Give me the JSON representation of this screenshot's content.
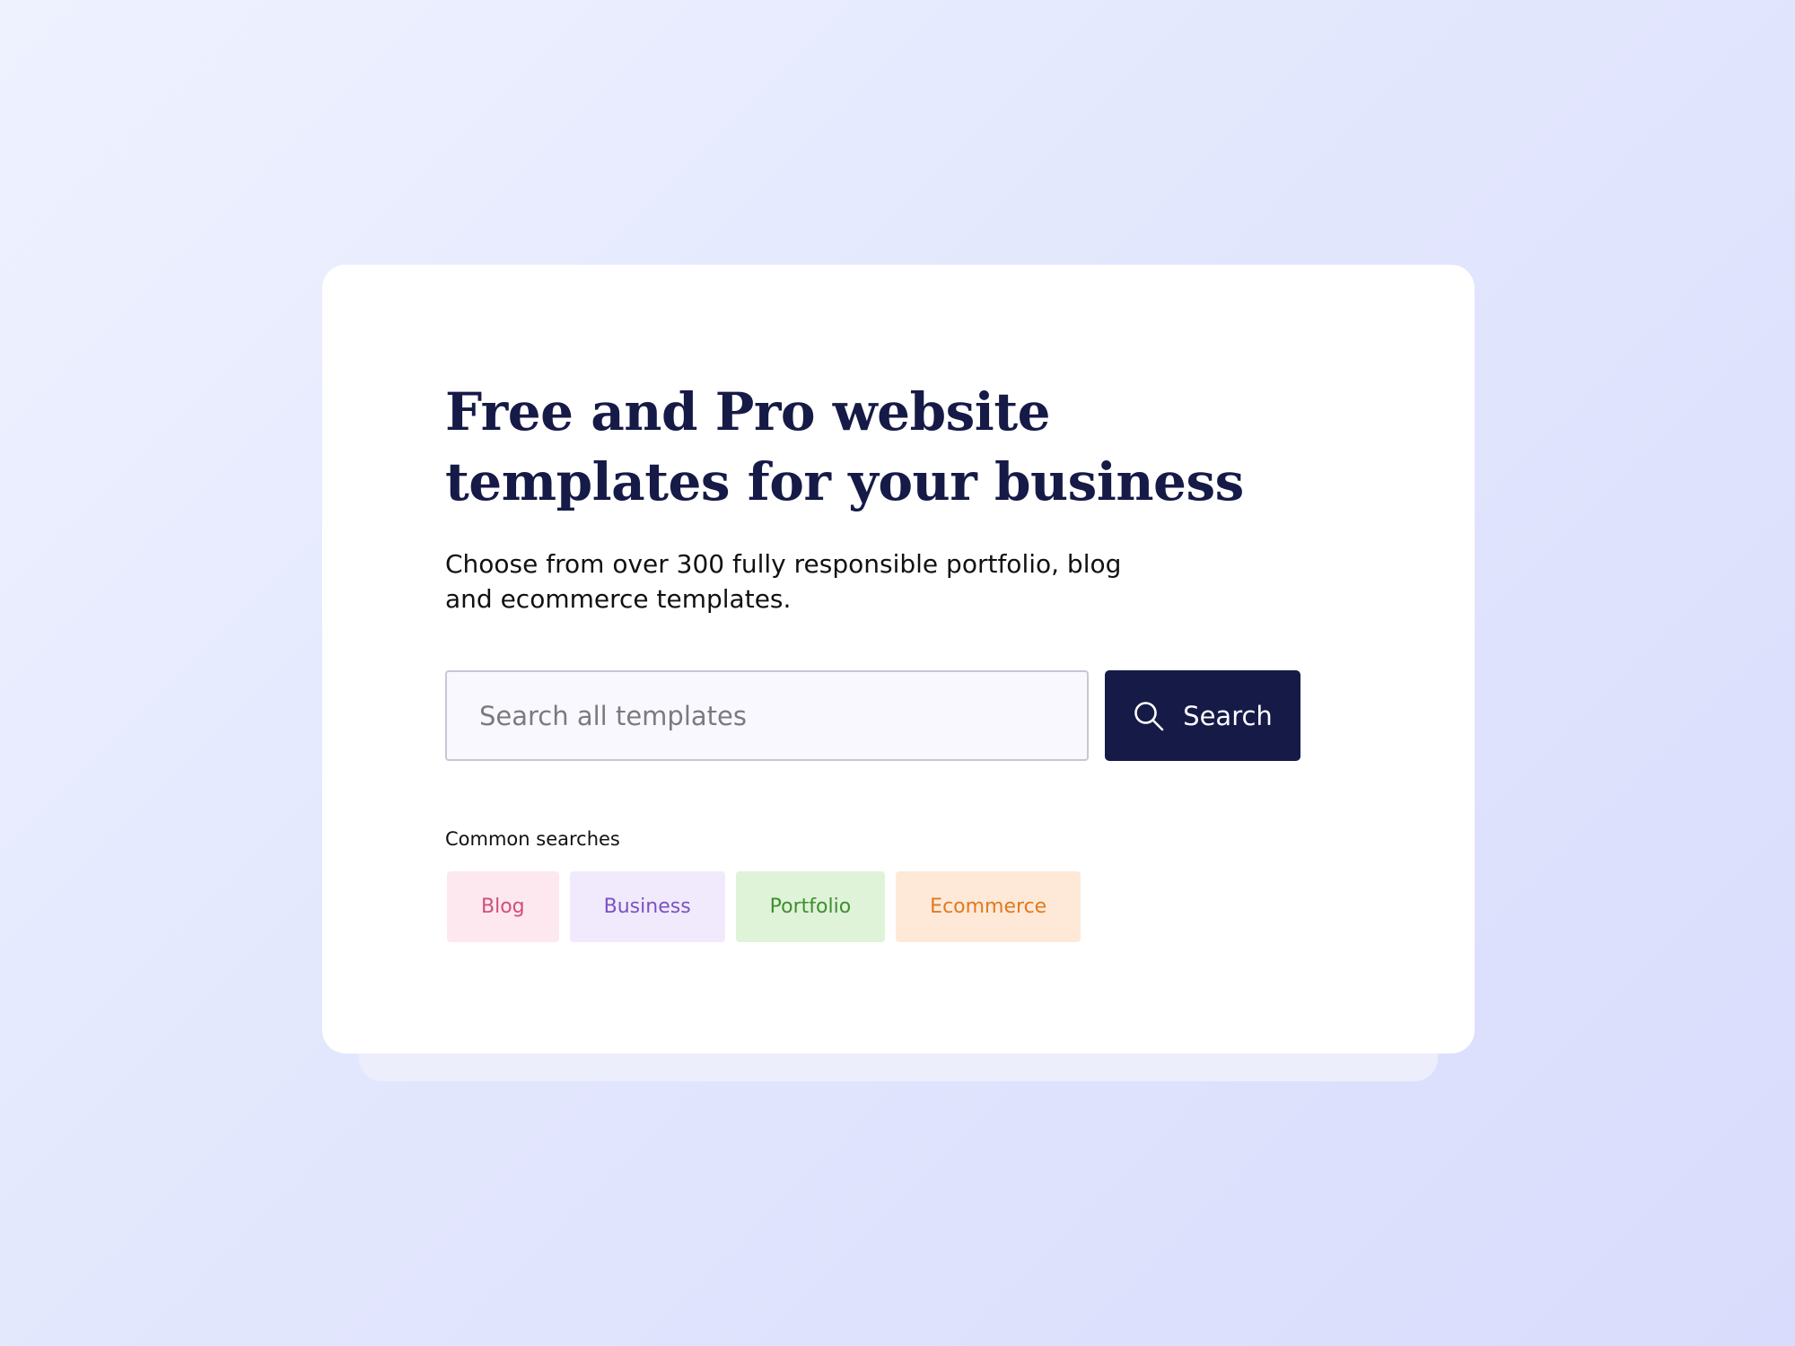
{
  "hero": {
    "title_line1": "Free and Pro website",
    "title_line2": "templates for your business",
    "subtitle_line1": "Choose from over 300 fully responsible portfolio, blog",
    "subtitle_line2": "and ecommerce templates."
  },
  "search": {
    "placeholder": "Search all templates",
    "value": "",
    "button_label": "Search",
    "button_icon": "search-icon"
  },
  "common_searches": {
    "label": "Common searches",
    "tags": [
      {
        "label": "Blog",
        "bg": "#fde8ef",
        "color": "#d04f7a"
      },
      {
        "label": "Business",
        "bg": "#f1eafd",
        "color": "#7b52c2"
      },
      {
        "label": "Portfolio",
        "bg": "#dff3d9",
        "color": "#3f8f2f"
      },
      {
        "label": "Ecommerce",
        "bg": "#fee9d8",
        "color": "#e07a1f"
      }
    ]
  },
  "colors": {
    "primary": "#161a47",
    "card": "#ffffff",
    "input_bg": "#f9f8ff"
  }
}
